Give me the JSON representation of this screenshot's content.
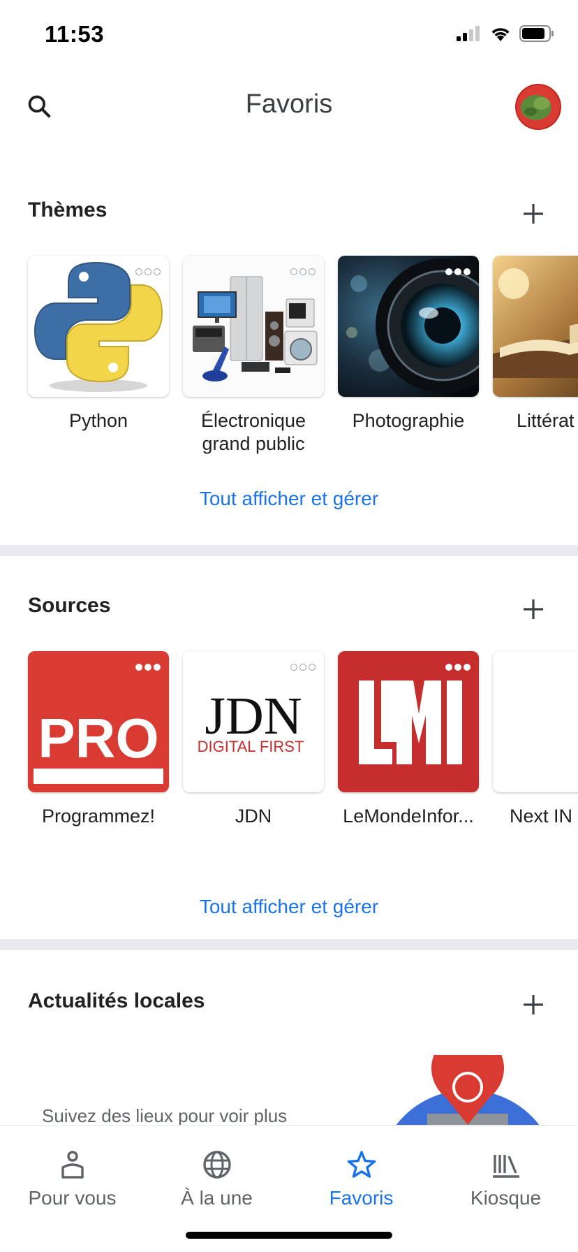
{
  "status_bar": {
    "time": "11:53"
  },
  "header": {
    "title": "Favoris",
    "avatar": "avatar"
  },
  "themes": {
    "title": "Thèmes",
    "items": [
      {
        "label": "Python"
      },
      {
        "label": "Électronique\ngrand public"
      },
      {
        "label": "Photographie"
      },
      {
        "label": "Littérat"
      }
    ],
    "see_all": "Tout afficher et gérer"
  },
  "sources": {
    "title": "Sources",
    "items": [
      {
        "label": "Programmez!",
        "logo_text": "PRO"
      },
      {
        "label": "JDN",
        "logo_text": "JDN",
        "logo_subtext": "DIGITAL FIRST"
      },
      {
        "label": "LeMondeInfor...",
        "logo_text": "LMI"
      },
      {
        "label": "Next IN"
      }
    ],
    "see_all": "Tout afficher et gérer"
  },
  "local": {
    "title": "Actualités locales",
    "body": "Suivez des lieux pour voir plus"
  },
  "bottom_nav": {
    "items": [
      {
        "label": "Pour vous",
        "icon": "person-icon"
      },
      {
        "label": "À la une",
        "icon": "globe-icon"
      },
      {
        "label": "Favoris",
        "icon": "star-icon"
      },
      {
        "label": "Kiosque",
        "icon": "newsstand-icon"
      }
    ],
    "active": "Favoris"
  },
  "colors": {
    "accent": "#1a73e8",
    "divider": "#e8eaed",
    "pro_red": "#d93b33",
    "lmi_red": "#c62d2d"
  }
}
